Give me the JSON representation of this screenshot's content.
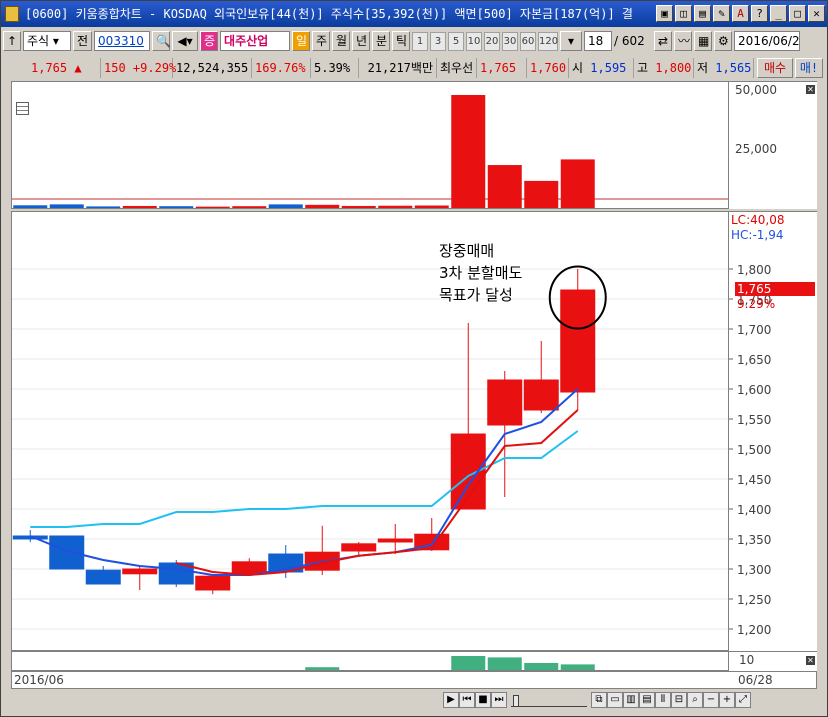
{
  "title": "[0600] 키움종합차트 - KOSDAQ 외국인보유[44(천)] 주식수[35,392(천)] 액면[500] 자본금[187(억)] 결",
  "toolbar": {
    "market_select": "주식",
    "jeon_label": "전",
    "code_value": "003310",
    "stock_badge": "증",
    "stock_name": "대주산업",
    "period_active": "일",
    "periods": [
      "주",
      "월",
      "년",
      "분",
      "틱"
    ],
    "minute_intervals": [
      "1",
      "3",
      "5",
      "10",
      "20",
      "30",
      "60",
      "120"
    ],
    "count_value": "18",
    "count_total": "/ 602",
    "date_value": "2016/06/2"
  },
  "quote": {
    "price": "1,765",
    "arrow": "▲",
    "change": "150",
    "change_pct": "+9.29%",
    "volume": "12,524,355",
    "volume_pct": "169.76%",
    "turnover": "5.39%",
    "amount": "21,217백만",
    "best_label": "최우선",
    "best_ask": "1,765",
    "best_bid": "1,760",
    "open_label": "시",
    "open": "1,595",
    "high_label": "고",
    "high": "1,800",
    "low_label": "저",
    "low": "1,565",
    "buy_button": "매수",
    "sell_button": "매!"
  },
  "axis_volume": [
    "50,000",
    "25,000"
  ],
  "axis_price": [
    "1,800",
    "1,750",
    "1,700",
    "1,650",
    "1,600",
    "1,550",
    "1,500",
    "1,450",
    "1,400",
    "1,350",
    "1,300",
    "1,250",
    "1,200"
  ],
  "lc_label": "LC:40,08",
  "hc_label": "HC:-1,94",
  "current_price_tag": "1,765",
  "current_pct_tag": "9.29%",
  "axis_sub": "10",
  "annotation": [
    "장중매매",
    "3차 분할매도",
    "목표가 달성"
  ],
  "date_start": "2016/06",
  "date_end": "06/28",
  "colors": {
    "up": "#e81010",
    "down": "#1060d0",
    "ma_short": "#e01010",
    "ma_mid": "#2050e0",
    "ma_long": "#20c0f0"
  },
  "chart_data": {
    "type": "candlestick",
    "candles": [
      {
        "o": 1355,
        "h": 1365,
        "l": 1345,
        "c": 1350
      },
      {
        "o": 1355,
        "h": 1355,
        "l": 1300,
        "c": 1300
      },
      {
        "o": 1298,
        "h": 1305,
        "l": 1275,
        "c": 1275
      },
      {
        "o": 1292,
        "h": 1305,
        "l": 1265,
        "c": 1300
      },
      {
        "o": 1310,
        "h": 1315,
        "l": 1270,
        "c": 1275
      },
      {
        "o": 1265,
        "h": 1290,
        "l": 1258,
        "c": 1288
      },
      {
        "o": 1292,
        "h": 1318,
        "l": 1290,
        "c": 1312
      },
      {
        "o": 1325,
        "h": 1340,
        "l": 1285,
        "c": 1295
      },
      {
        "o": 1298,
        "h": 1372,
        "l": 1290,
        "c": 1328
      },
      {
        "o": 1330,
        "h": 1345,
        "l": 1322,
        "c": 1342
      },
      {
        "o": 1345,
        "h": 1375,
        "l": 1325,
        "c": 1350
      },
      {
        "o": 1332,
        "h": 1385,
        "l": 1330,
        "c": 1358
      },
      {
        "o": 1400,
        "h": 1710,
        "l": 1400,
        "c": 1525
      },
      {
        "o": 1540,
        "h": 1630,
        "l": 1420,
        "c": 1615
      },
      {
        "o": 1565,
        "h": 1680,
        "l": 1560,
        "c": 1615
      },
      {
        "o": 1595,
        "h": 1800,
        "l": 1565,
        "c": 1765
      }
    ],
    "ma_short": [
      null,
      null,
      null,
      null,
      1310,
      1295,
      1290,
      1295,
      1310,
      1322,
      1328,
      1335,
      1420,
      1505,
      1510,
      1565
    ],
    "ma_mid": [
      1355,
      1330,
      1315,
      1305,
      1300,
      1290,
      1290,
      1300,
      1312,
      1322,
      1328,
      1340,
      1440,
      1525,
      1545,
      1600
    ],
    "ma_long": [
      1370,
      1370,
      1375,
      1375,
      1395,
      1395,
      1400,
      1400,
      1405,
      1405,
      1405,
      1405,
      1455,
      1485,
      1485,
      1530
    ],
    "volume": [
      1200,
      1600,
      700,
      900,
      800,
      600,
      800,
      1600,
      1400,
      900,
      1000,
      1100,
      50000,
      19000,
      12000,
      21500
    ],
    "sub_volume": [
      0,
      0,
      0,
      0,
      0,
      0,
      0,
      0,
      2,
      0,
      0,
      0,
      10,
      9,
      5,
      4
    ],
    "ylim": [
      1200,
      1800
    ],
    "volume_max": 50000
  }
}
